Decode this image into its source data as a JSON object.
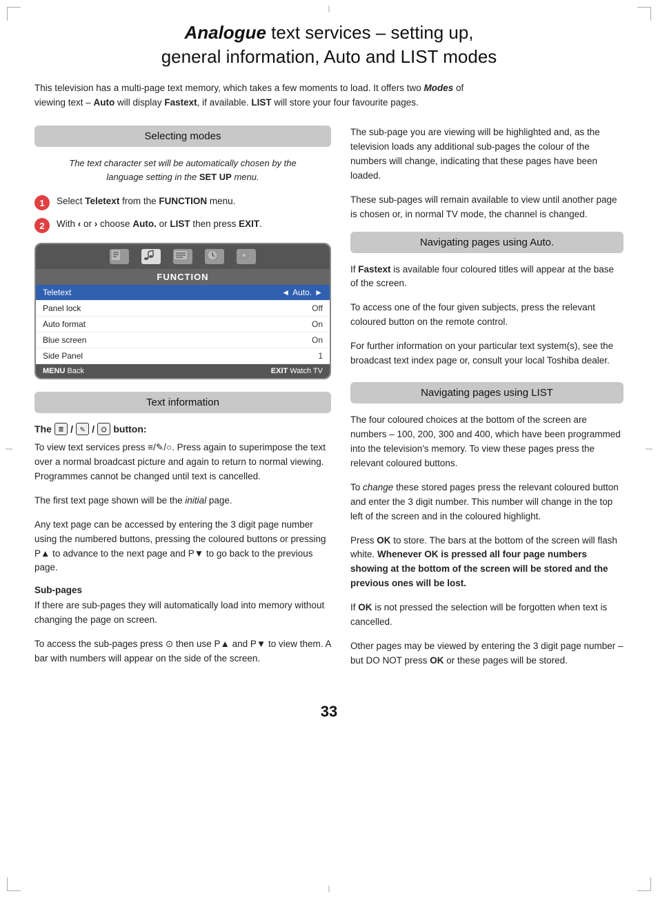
{
  "page": {
    "number": "33"
  },
  "title": {
    "bold_part": "Analogue",
    "rest": " text services – setting up,\ngeneral information, Auto and LIST modes"
  },
  "intro": {
    "text": "This television has a multi-page text memory, which takes a few moments to load. It offers two ",
    "bold_italic": "Modes",
    "text2": " of\nviewing text – ",
    "auto": "Auto",
    "text3": " will display ",
    "fastext": "Fastext",
    "text4": ", if available. ",
    "list": "LIST",
    "text5": " will store your four favourite pages."
  },
  "selecting_modes": {
    "heading": "Selecting modes",
    "italic_note_line1": "The text character set will be automatically chosen by the",
    "italic_note_line2": "language setting in the",
    "italic_note_bold": "SET UP",
    "italic_note_line3": "menu.",
    "step1": "Select",
    "step1_bold": "Teletext",
    "step1_rest": "from the",
    "step1_menu": "FUNCTION",
    "step1_end": "menu.",
    "step2_start": "With",
    "step2_langle": "‹",
    "step2_or": "or",
    "step2_rangle": "›",
    "step2_mid": "choose",
    "step2_auto": "Auto.",
    "step2_or2": "or",
    "step2_list": "LIST",
    "step2_then": "then press",
    "step2_exit": "EXIT",
    "step2_end": "."
  },
  "tv_menu": {
    "title": "FUNCTION",
    "rows": [
      {
        "label": "Teletext",
        "value": "Auto.",
        "arrow_left": true,
        "arrow_right": true,
        "highlighted": true
      },
      {
        "label": "Panel lock",
        "value": "Off",
        "highlighted": false
      },
      {
        "label": "Auto format",
        "value": "On",
        "highlighted": false
      },
      {
        "label": "Blue screen",
        "value": "On",
        "highlighted": false
      },
      {
        "label": "Side Panel",
        "value": "1",
        "highlighted": false
      }
    ],
    "footer_left": "MENU",
    "footer_left_action": "Back",
    "footer_right": "EXIT",
    "footer_right_action": "Watch TV"
  },
  "text_information": {
    "heading": "Text information",
    "button_label": "The",
    "button_label_end": "button:",
    "para1": "To view text services press ≡/✎/○. Press again to superimpose the text over a normal broadcast picture and again to return to normal viewing. Programmes cannot be changed until text is cancelled.",
    "para2": "The first text page shown will be the",
    "para2_italic": "initial",
    "para2_end": "page.",
    "para3": "Any text page can be accessed by entering the 3 digit page number using the numbered buttons, pressing the coloured buttons or pressing P▲ to advance to the next page and P▼ to go back to the previous page.",
    "subpages_heading": "Sub-pages",
    "subpages_para1": "If there are sub-pages they will automatically load into memory without changing the page on screen.",
    "subpages_para2": "To access the sub-pages press ⊙ then use P▲ and  P▼ to view them. A bar with numbers will appear on the side of the screen."
  },
  "right_col": {
    "nav_auto_heading": "Navigating pages using Auto.",
    "nav_auto_para1": "If Fastext is available four coloured titles will appear at the base of the screen.",
    "nav_auto_para2": "To access one of the four given subjects, press the relevant coloured button on the remote control.",
    "nav_auto_para3": "For further information on your particular text system(s), see the broadcast text index page or, consult your local Toshiba dealer.",
    "nav_list_heading": "Navigating pages using LIST",
    "nav_list_para1": "The four coloured choices at the bottom of the screen are numbers – 100, 200, 300 and 400, which have been programmed into the television's memory. To view these pages press the relevant coloured buttons.",
    "nav_list_para2": "To",
    "nav_list_para2_italic": "change",
    "nav_list_para2_rest": "these stored pages press the relevant coloured button and enter the 3 digit number. This number will change in the top left of the screen and in the coloured highlight.",
    "nav_list_para3_start": "Press",
    "nav_list_para3_ok": "OK",
    "nav_list_para3_rest": "to store. The bars at the bottom of the screen will flash white.",
    "nav_list_para3_bold": "Whenever OK is pressed all four page numbers showing at the bottom of the screen will be stored and the previous ones will be lost.",
    "nav_list_para4_start": "If",
    "nav_list_para4_ok": "OK",
    "nav_list_para4_rest": "is not pressed the selection will be forgotten when text is cancelled.",
    "nav_list_para5": "Other pages may be viewed by entering the 3 digit page number – but DO NOT press",
    "nav_list_para5_ok": "OK",
    "nav_list_para5_rest": "or these pages will be stored.",
    "subpage_highlight_para1": "The sub-page you are viewing will be highlighted and, as the television loads any additional sub-pages the colour of the numbers will change, indicating that these pages have been loaded.",
    "subpage_highlight_para2": "These sub-pages will remain available to view until another page is chosen or, in normal TV mode, the channel is changed."
  }
}
